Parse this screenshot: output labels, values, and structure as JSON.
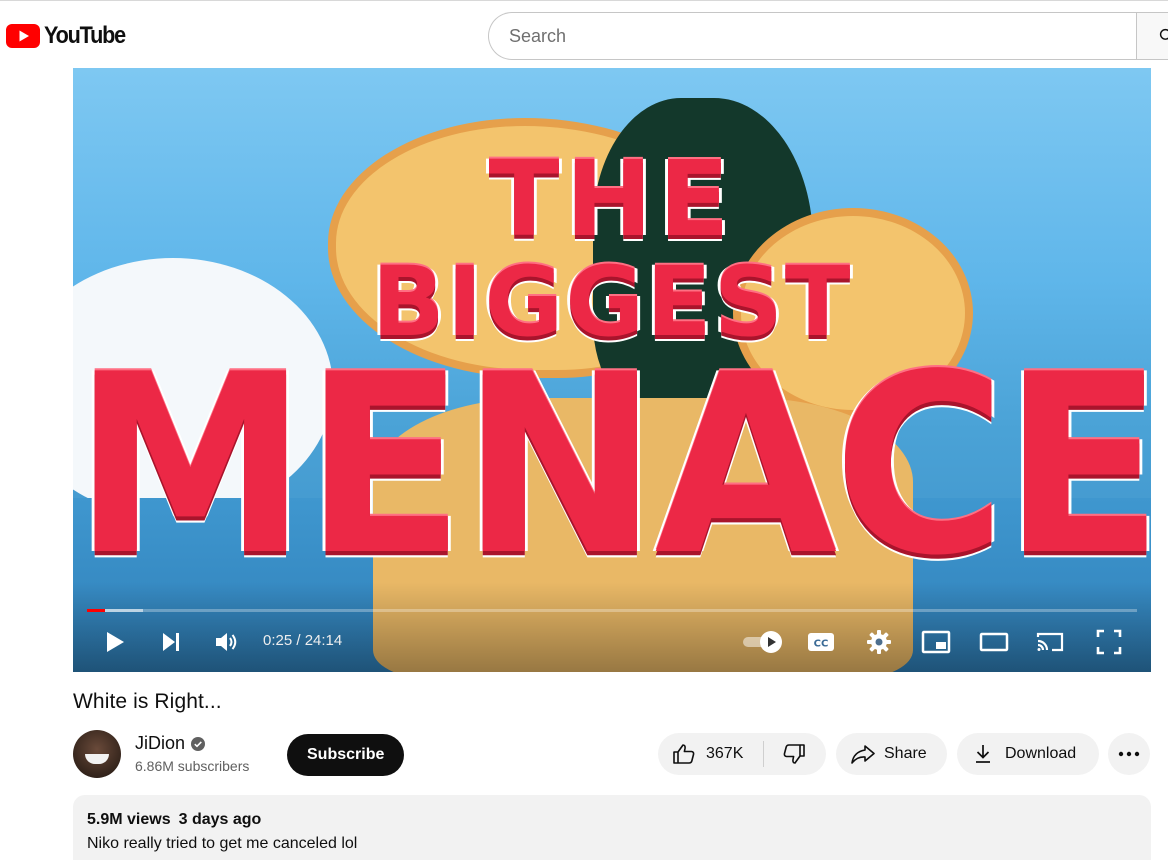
{
  "brand": {
    "name": "YouTube",
    "color": "#ff0000"
  },
  "search": {
    "placeholder": "Search",
    "value": "",
    "icon": "search-icon"
  },
  "player": {
    "thumbnail_text": {
      "line1": "THE",
      "line2": "BIGGEST",
      "line3": "MENACE"
    },
    "time": "0:25 / 24:14",
    "progress_played": 0.0172,
    "progress_loaded": 0.053,
    "controls": [
      "play-icon",
      "next-icon",
      "volume-icon",
      "autoplay-toggle",
      "captions-icon",
      "settings-icon",
      "miniplayer-icon",
      "theater-icon",
      "cast-icon",
      "fullscreen-icon"
    ],
    "captions_label": "CC"
  },
  "video": {
    "title": "White is Right...",
    "channel": {
      "name": "JiDion",
      "subscribers": "6.86M subscribers",
      "verified": true
    },
    "subscribe_label": "Subscribe",
    "likes": "367K",
    "share_label": "Share",
    "download_label": "Download"
  },
  "description": {
    "views": "5.9M views",
    "date": "3 days ago",
    "text": "Niko really tried to get me canceled lol"
  }
}
